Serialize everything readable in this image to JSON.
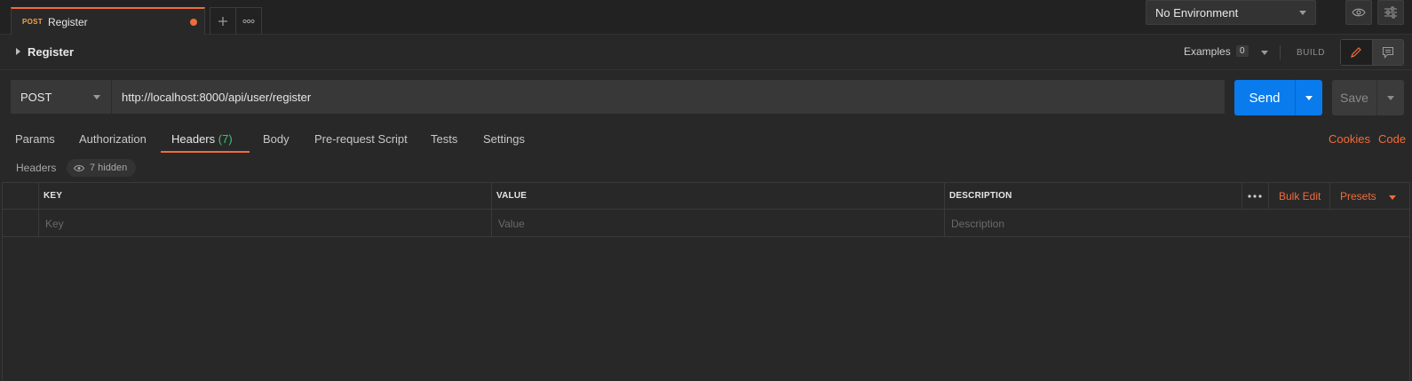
{
  "tab": {
    "method": "POST",
    "name": "Register"
  },
  "environment": {
    "selected": "No Environment"
  },
  "request": {
    "title": "Register",
    "examples_label": "Examples",
    "examples_count": "0",
    "build_label": "BUILD",
    "method": "POST",
    "url": "http://localhost:8000/api/user/register",
    "send_label": "Send",
    "save_label": "Save"
  },
  "subtabs": {
    "params": "Params",
    "authorization": "Authorization",
    "headers": "Headers",
    "headers_count": "(7)",
    "body": "Body",
    "prerequest": "Pre-request Script",
    "tests": "Tests",
    "settings": "Settings",
    "cookies": "Cookies",
    "code": "Code"
  },
  "headers_section": {
    "label": "Headers",
    "hidden_label": "7 hidden"
  },
  "table": {
    "columns": {
      "key": "KEY",
      "value": "VALUE",
      "description": "DESCRIPTION"
    },
    "placeholders": {
      "key": "Key",
      "value": "Value",
      "description": "Description"
    },
    "bulk_edit": "Bulk Edit",
    "presets": "Presets"
  },
  "colors": {
    "accent": "#f26b3a",
    "send": "#097bed",
    "count": "#3ec27a"
  }
}
